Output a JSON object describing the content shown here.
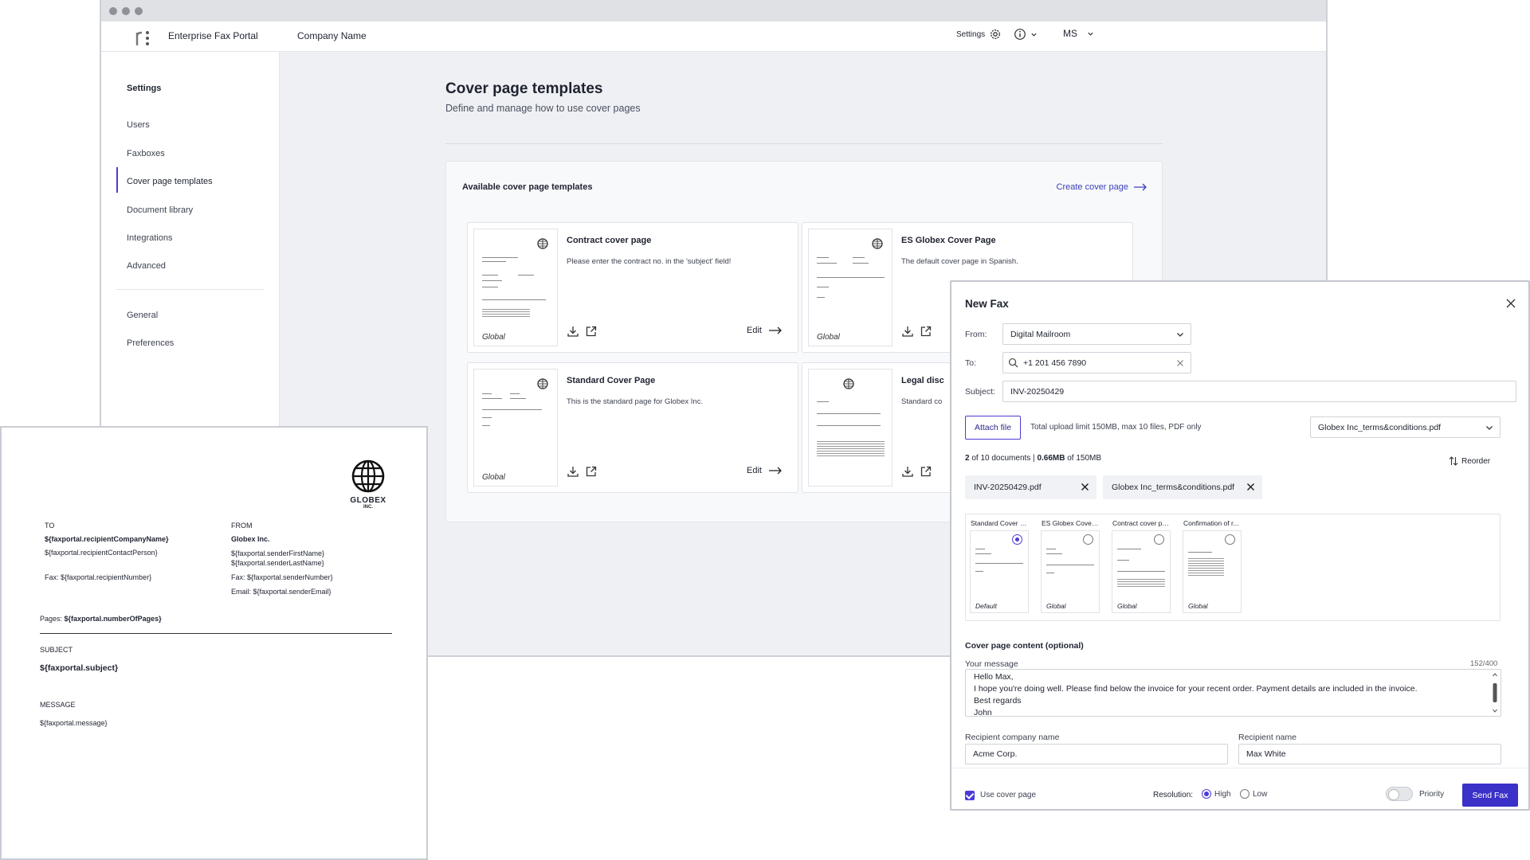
{
  "topbar": {
    "app_title": "Enterprise Fax Portal",
    "company": "Company Name",
    "settings_label": "Settings",
    "user_initials": "MS"
  },
  "sidebar": {
    "heading": "Settings",
    "items": [
      "Users",
      "Faxboxes",
      "Cover page templates",
      "Document library",
      "Integrations",
      "Advanced"
    ],
    "items2": [
      "General",
      "Preferences"
    ]
  },
  "main": {
    "title": "Cover page templates",
    "subtitle": "Define and manage how to use cover pages",
    "panel_title": "Available cover page templates",
    "create_link": "Create cover page"
  },
  "templates": [
    {
      "title": "Contract cover page",
      "desc": "Please enter the contract no. in the 'subject' field!",
      "scope": "Global",
      "edit": "Edit"
    },
    {
      "title": "ES Globex Cover Page",
      "desc": "The default cover page in Spanish.",
      "scope": "Global",
      "edit": "Edit"
    },
    {
      "title": "Standard Cover Page",
      "desc": "This is the standard page for Globex Inc.",
      "scope": "Global",
      "edit": "Edit"
    },
    {
      "title": "Legal disc",
      "desc": "Standard co",
      "scope": "",
      "edit": ""
    }
  ],
  "cover_preview": {
    "logo_text": "GLOBEX",
    "logo_sub": "INC.",
    "to_label": "TO",
    "to_company": "${faxportal.recipientCompanyName}",
    "to_contact": "${faxportal.recipientContactPerson}",
    "to_fax": "Fax: ${faxportal.recipientNumber}",
    "from_label": "FROM",
    "from_company": "Globex Inc.",
    "from_first": "${faxportal.senderFirstName}",
    "from_last": "${faxportal.senderLastName}",
    "from_fax": "Fax: ${faxportal.senderNumber}",
    "from_email": "Email: ${faxportal.senderEmail}",
    "pages_label": "Pages:",
    "pages_value": "${faxportal.numberOfPages}",
    "subject_label": "SUBJECT",
    "subject_value": "${faxportal.subject}",
    "message_label": "MESSAGE",
    "message_value": "${faxportal.message}"
  },
  "new_fax": {
    "title": "New Fax",
    "from_label": "From:",
    "from_value": "Digital Mailroom",
    "to_label": "To:",
    "to_value": "+1 201 456 7890",
    "subject_label": "Subject:",
    "subject_value": "INV-20250429",
    "attach_label": "Attach file",
    "upload_info": "Total upload limit 150MB, max 10 files, PDF only",
    "file_select": "Globex Inc_terms&conditions.pdf",
    "doc_count": "2",
    "doc_count_rest": "of 10 documents |",
    "doc_size": "0.66MB",
    "doc_size_rest": "of 150MB",
    "reorder": "Reorder",
    "files": [
      "INV-20250429.pdf",
      "Globex Inc_terms&conditions.pdf"
    ],
    "cover_options": [
      {
        "name": "Standard Cover Page",
        "scope": "Default",
        "selected": true
      },
      {
        "name": "ES Globex Cover Page",
        "scope": "Global",
        "selected": false
      },
      {
        "name": "Contract cover page",
        "scope": "Global",
        "selected": false
      },
      {
        "name": "Confirmation of r...",
        "scope": "Global",
        "selected": false
      }
    ],
    "content_heading": "Cover page content (optional)",
    "message_label": "Your message",
    "message_count": "152/400",
    "message_lines": [
      "Hello Max,",
      "I hope you're doing well. Please find below the invoice for your recent order. Payment details are included in the invoice.",
      "Best regards",
      "John"
    ],
    "recipient_company_label": "Recipient company name",
    "recipient_company_value": "Acme Corp.",
    "recipient_name_label": "Recipient name",
    "recipient_name_value": "Max White",
    "use_cover_label": "Use cover page",
    "resolution_label": "Resolution:",
    "res_high": "High",
    "res_low": "Low",
    "priority_label": "Priority",
    "send_label": "Send Fax"
  },
  "colors": {
    "accent": "#4b3bd6",
    "link": "#3b3fb8",
    "background": "#eef0f4"
  }
}
